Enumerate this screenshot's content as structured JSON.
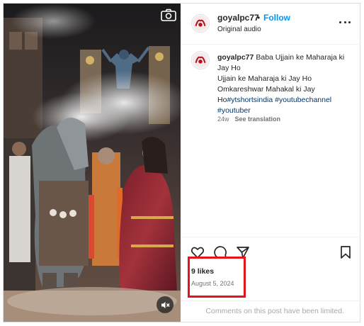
{
  "post": {
    "username": "goyalpc77",
    "separator": "•",
    "follow_label": "Follow",
    "audio_label": "Original audio",
    "more_label": "More options"
  },
  "caption": {
    "username": "goyalpc77",
    "line1": "Baba Ujjain ke Maharaja ki Jay Ho",
    "line2": "Ujjain ke Maharaja ki Jay Ho",
    "line3": "Omkareshwar Mahakal ki Jay",
    "line4_prefix": "Ho",
    "tag1": "#ytshortsindia",
    "tag2": "#youtubechannel",
    "tag3": "#youtuber",
    "age": "24w",
    "translate_label": "See translation"
  },
  "engagement": {
    "likes": "9 likes",
    "date": "August 5, 2024"
  },
  "comments_notice": "Comments on this post have been limited.",
  "icons": {
    "like": "heart-icon",
    "comment": "comment-icon",
    "share": "share-icon",
    "save": "bookmark-icon",
    "camera": "camera-icon",
    "mute": "mute-icon"
  },
  "colors": {
    "follow": "#0095f6",
    "highlight": "#e5141b",
    "secondary_text": "#737373",
    "hashtag": "#00376b"
  }
}
